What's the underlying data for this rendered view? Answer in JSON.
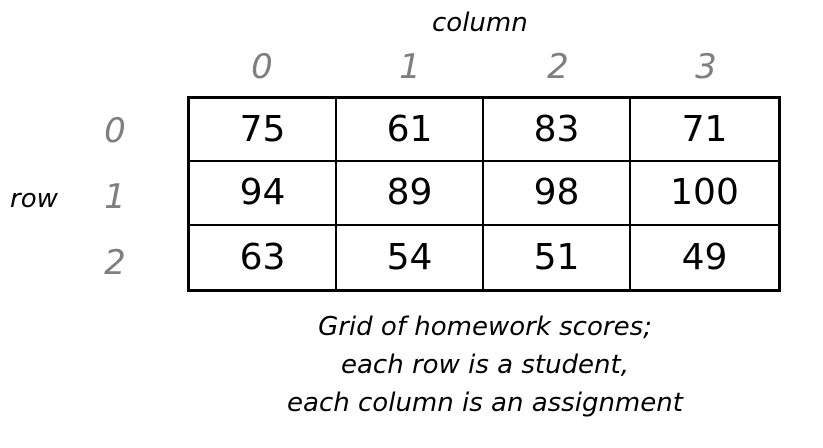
{
  "column_header": "column",
  "row_header": "row",
  "column_indices": [
    "0",
    "1",
    "2",
    "3"
  ],
  "row_indices": [
    "0",
    "1",
    "2"
  ],
  "grid": {
    "rows": [
      [
        "75",
        "61",
        "83",
        "71"
      ],
      [
        "94",
        "89",
        "98",
        "100"
      ],
      [
        "63",
        "54",
        "51",
        "49"
      ]
    ]
  },
  "caption": {
    "line1": "Grid of homework scores;",
    "line2": "each row is a student,",
    "line3": "each column is an assignment"
  },
  "colors": {
    "index_gray": "#7f7f7f",
    "text": "#000000",
    "border": "#000000"
  }
}
